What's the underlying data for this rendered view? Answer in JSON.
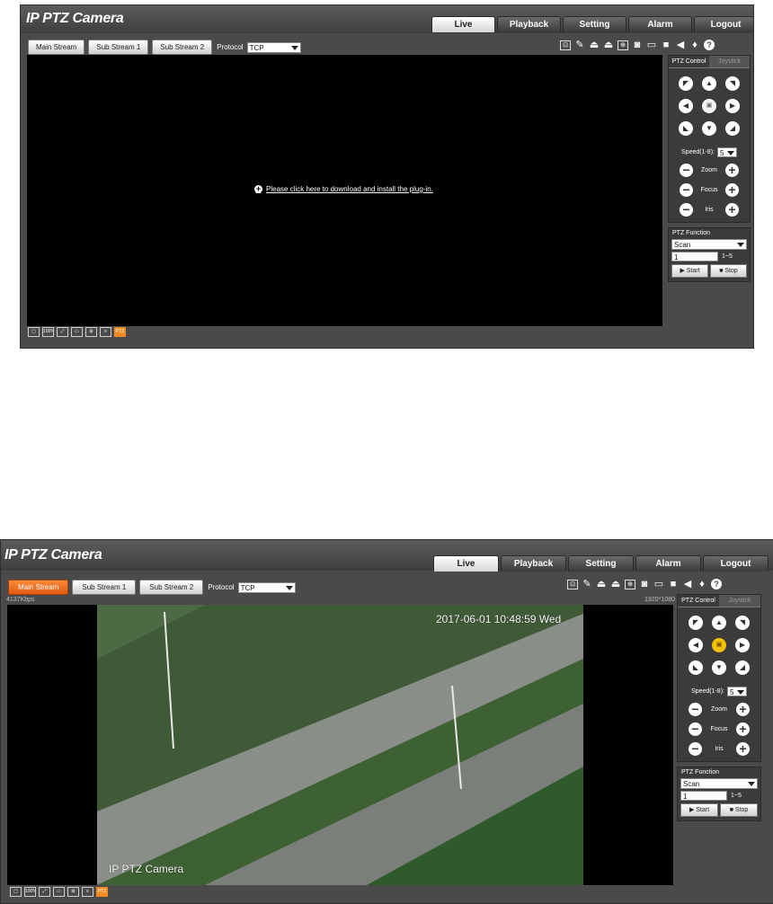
{
  "app": {
    "title": "IP PTZ Camera"
  },
  "tabs": [
    "Live",
    "Playback",
    "Setting",
    "Alarm",
    "Logout"
  ],
  "streams": {
    "main": "Main Stream",
    "sub1": "Sub Stream 1",
    "sub2": "Sub Stream 2",
    "protocol_label": "Protocol",
    "protocol_value": "TCP"
  },
  "plugin_message": "Please click here to download and install the plug-in.",
  "ptz": {
    "tab_control": "PTZ Control",
    "tab_joystick": "Joystick",
    "speed_label": "Speed(1-8):",
    "speed_value": "5",
    "zoom": "Zoom",
    "focus": "Focus",
    "iris": "Iris"
  },
  "ptz_function": {
    "title": "PTZ Function",
    "mode": "Scan",
    "value": "1",
    "range": "1~5",
    "start": "▶ Start",
    "stop": "■ Stop"
  },
  "bottom_bar": [
    "▢",
    "100%",
    "⤢",
    "▭",
    "⊞",
    "≡",
    "PTZ"
  ],
  "live_view": {
    "bitrate": "4137Kbps",
    "resolution": "1920*1080",
    "osd_time": "2017-06-01 10:48:59 Wed",
    "osd_name": "IP PTZ Camera"
  },
  "colors": {
    "accent": "#f08a24",
    "active_stream": "#e25a10",
    "background": "#4a4a4a"
  }
}
